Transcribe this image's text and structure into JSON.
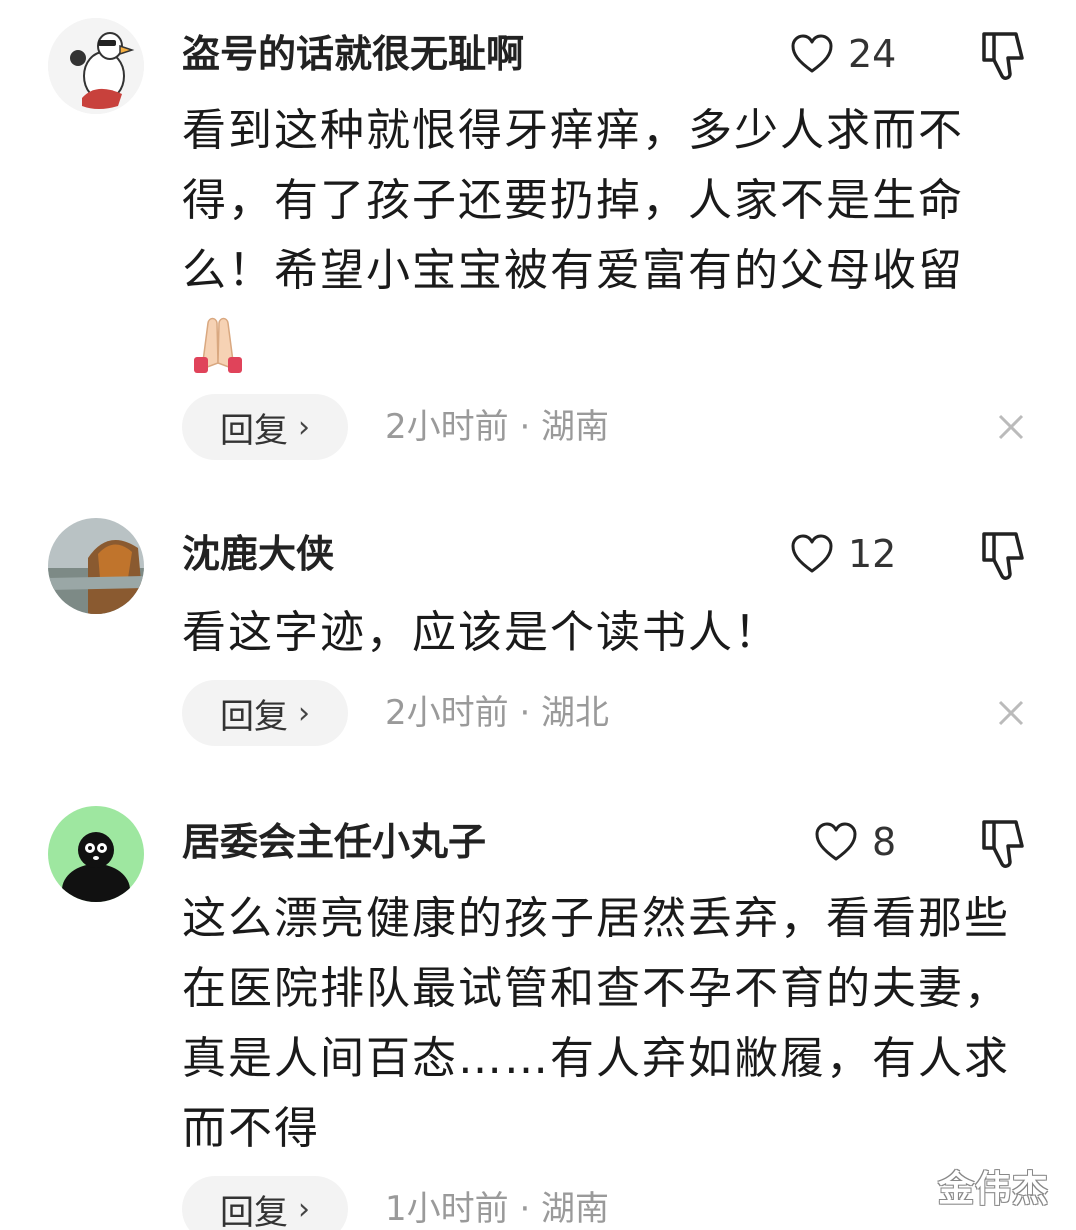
{
  "comments": [
    {
      "username": "盗号的话就很无耻啊",
      "likes": "24",
      "text": "看到这种就恨得牙痒痒，多少人求而不得，有了孩子还要扔掉，人家不是生命么！希望小宝宝被有爱富有的父母收留",
      "emoji_icon": "folded-hands-emoji",
      "reply_label": "回复",
      "meta": "2小时前 · 湖南"
    },
    {
      "username": "沈鹿大侠",
      "likes": "12",
      "text": "看这字迹，应该是个读书人！",
      "reply_label": "回复",
      "meta": "2小时前 · 湖北"
    },
    {
      "username": "居委会主任小丸子",
      "likes": "8",
      "text": "这么漂亮健康的孩子居然丢弃，看看那些在医院排队最试管和查不孕不育的夫妻，真是人间百态……有人弃如敝履，有人求而不得",
      "reply_label": "回复",
      "meta": "1小时前 · 湖南"
    }
  ],
  "icons": {
    "like": "heart-outline-icon",
    "dislike": "thumbs-down-icon",
    "close": "close-icon",
    "reply_chevron": "chevron-right-icon"
  },
  "watermark": "金伟杰",
  "colors": {
    "reply_bg": "#f3f3f3",
    "meta_text": "#9a9a9a",
    "icon_stroke": "#222222",
    "avatar3_bg": "#9ee7a0"
  }
}
